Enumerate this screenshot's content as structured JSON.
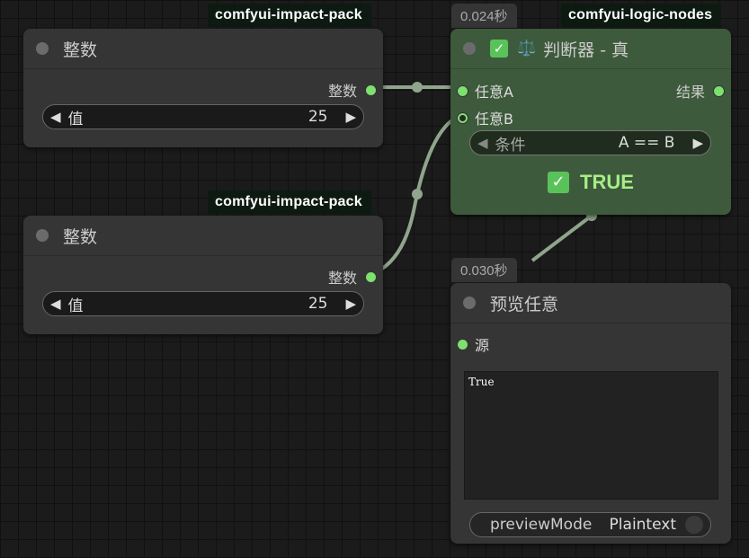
{
  "nodes": {
    "int1": {
      "pack": "comfyui-impact-pack",
      "title": "整数",
      "output": "整数",
      "widget_label": "值",
      "widget_value": "25"
    },
    "int2": {
      "pack": "comfyui-impact-pack",
      "title": "整数",
      "output": "整数",
      "widget_label": "值",
      "widget_value": "25"
    },
    "judge": {
      "pack": "comfyui-logic-nodes",
      "time": "0.024秒",
      "title": "判断器 - 真",
      "input_a": "任意A",
      "input_b": "任意B",
      "output": "结果",
      "condition_label": "条件",
      "condition_value": "A == B",
      "result": "TRUE",
      "check": "✓",
      "icon": "⚖️"
    },
    "preview": {
      "time": "0.030秒",
      "title": "预览任意",
      "input": "源",
      "content": "True",
      "mode_label": "previewMode",
      "mode_value": "Plaintext"
    }
  },
  "colors": {
    "canvas": "#1b1b1b",
    "node": "#353535",
    "node_green": "#3e5a3c",
    "port": "#7ee06e",
    "link": "#8fa58c",
    "true_text": "#a6ee86"
  }
}
